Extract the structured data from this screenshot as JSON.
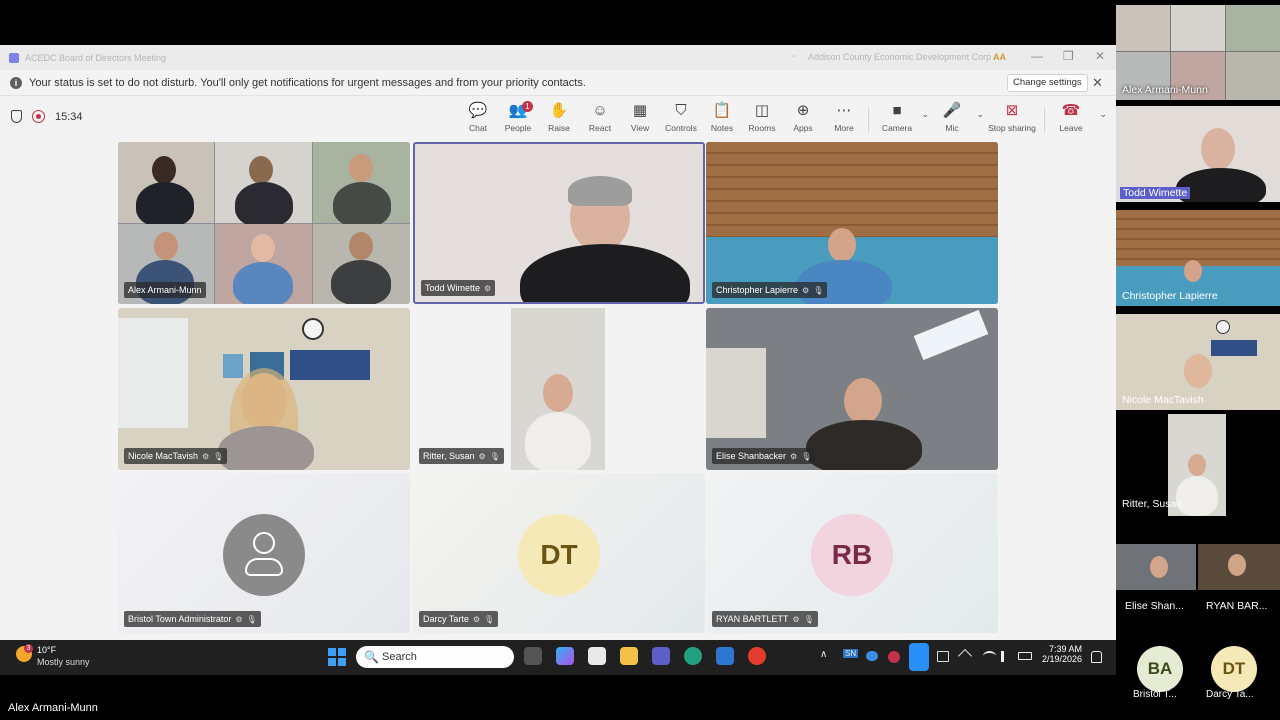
{
  "window": {
    "title": "ACEDC Board of Directors Meeting",
    "org": "Addison County Economic Development Corp",
    "org_badge": "AA",
    "dots": "⋯",
    "minimize": "—",
    "restore": "❐",
    "close": "✕"
  },
  "notification": {
    "message": "Your status is set to do not disturb. You'll only get notifications for urgent messages and from your priority contacts.",
    "button": "Change settings",
    "close": "✕",
    "info": "i"
  },
  "toolbar": {
    "timer": "15:34",
    "people_badge": "1",
    "buttons": [
      {
        "label": "Chat",
        "icon": "chat-icon",
        "glyph": "💬"
      },
      {
        "label": "People",
        "icon": "people-icon",
        "glyph": "👥"
      },
      {
        "label": "Raise",
        "icon": "hand-icon",
        "glyph": "✋"
      },
      {
        "label": "React",
        "icon": "smiley-icon",
        "glyph": "☺"
      },
      {
        "label": "View",
        "icon": "grid-view-icon",
        "glyph": "▦"
      },
      {
        "label": "Controls",
        "icon": "shield-controls-icon",
        "glyph": "⛉"
      },
      {
        "label": "Notes",
        "icon": "notes-icon",
        "glyph": "📋"
      },
      {
        "label": "Rooms",
        "icon": "rooms-icon",
        "glyph": "◫"
      },
      {
        "label": "Apps",
        "icon": "apps-icon",
        "glyph": "⊕"
      },
      {
        "label": "More",
        "icon": "more-icon",
        "glyph": "⋯"
      },
      {
        "label": "Camera",
        "icon": "camera-icon",
        "glyph": "■"
      },
      {
        "label": "Mic",
        "icon": "mic-icon",
        "glyph": "🎤"
      },
      {
        "label": "Stop sharing",
        "icon": "stop-share-icon",
        "glyph": "⊠"
      },
      {
        "label": "Leave",
        "icon": "leave-phone-icon",
        "glyph": "☎"
      }
    ],
    "chevron": "⌄"
  },
  "grid": {
    "tiles": [
      {
        "name": "Alex Armani-Munn"
      },
      {
        "name": "Todd Wimette"
      },
      {
        "name": "Christopher Lapierre"
      },
      {
        "name": "Nicole MacTavish"
      },
      {
        "name": "Ritter, Susan"
      },
      {
        "name": "Elise Shanbacker"
      },
      {
        "name": "Bristol Town Administrator"
      },
      {
        "name": "Darcy Tarte",
        "initials": "DT"
      },
      {
        "name": "RYAN BARTLETT",
        "initials": "RB"
      }
    ],
    "mic_glyph": "🎙",
    "share_glyph": "⚙"
  },
  "strip": {
    "names": [
      "Alex Armani-Munn",
      "Todd Wimette",
      "Christopher Lapierre",
      "Nicole MacTavish",
      "Ritter, Susan",
      "Elise Shan...",
      "RYAN BAR..."
    ],
    "avatars": [
      {
        "initials": "BA",
        "name": "Bristol T..."
      },
      {
        "initials": "DT",
        "name": "Darcy Ta..."
      }
    ]
  },
  "taskbar": {
    "weather_badge": "3",
    "temperature": "10°F",
    "condition": "Mostly sunny",
    "search_placeholder": "Search",
    "search_glyph": "🔍",
    "time": "7:39 AM",
    "date": "2/19/2026",
    "tray_chevron": "∧",
    "tray_sn": "SN"
  },
  "footer": {
    "speaker_name": "Alex Armani-Munn"
  },
  "colors": {
    "accent": "#5b5fc7",
    "leave": "#c4314b",
    "dt_avatar": "#f6e9b8",
    "rb_avatar": "#f2d4de"
  }
}
